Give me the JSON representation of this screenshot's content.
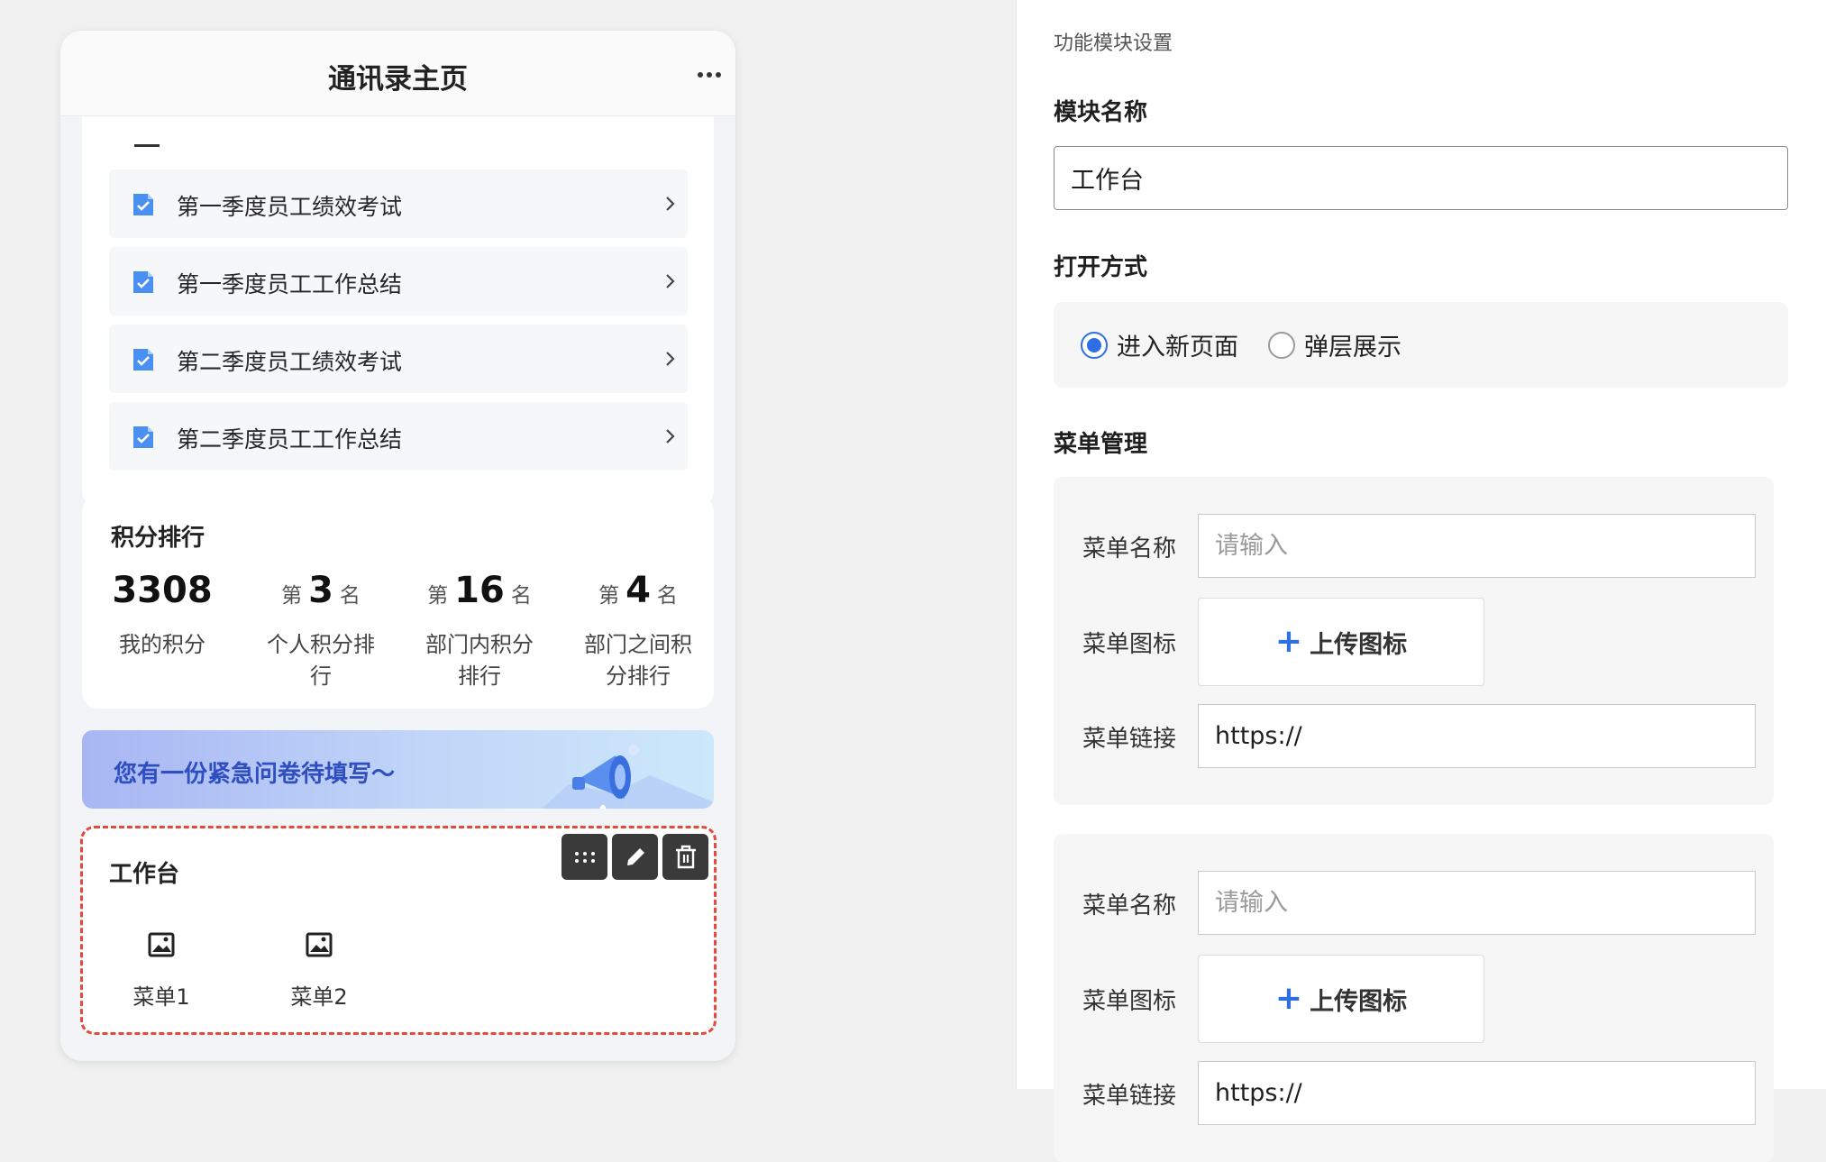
{
  "phone": {
    "title": "通讯录主页",
    "docs": [
      {
        "label": "第一季度员工绩效考试"
      },
      {
        "label": "第一季度员工工作总结"
      },
      {
        "label": "第二季度员工绩效考试"
      },
      {
        "label": "第二季度员工工作总结"
      }
    ],
    "score": {
      "title": "积分排行",
      "rank_prefix": "第",
      "rank_suffix": "名",
      "my_points": "3308",
      "my_points_label": "我的积分",
      "personal_rank": "3",
      "personal_rank_label": "个人积分排行",
      "dept_rank": "16",
      "dept_rank_label": "部门内积分排行",
      "inter_dept_rank": "4",
      "inter_dept_rank_label": "部门之间积分排行"
    },
    "banner": {
      "text": "您有一份紧急问卷待填写～"
    },
    "workbench": {
      "title": "工作台",
      "menus": [
        {
          "label": "菜单1"
        },
        {
          "label": "菜单2"
        }
      ]
    }
  },
  "panel": {
    "heading": "功能模块设置",
    "module_name_label": "模块名称",
    "module_name_value": "工作台",
    "open_mode_label": "打开方式",
    "open_mode_options": [
      {
        "label": "进入新页面",
        "selected": true
      },
      {
        "label": "弹层展示",
        "selected": false
      }
    ],
    "menu_manage_label": "菜单管理",
    "menu_groups": [
      {
        "name_label": "菜单名称",
        "name_placeholder": "请输入",
        "name_value": "",
        "icon_label": "菜单图标",
        "upload_text": "上传图标",
        "link_label": "菜单链接",
        "link_value": "https://"
      },
      {
        "name_label": "菜单名称",
        "name_placeholder": "请输入",
        "name_value": "",
        "icon_label": "菜单图标",
        "upload_text": "上传图标",
        "link_label": "菜单链接",
        "link_value": "https://"
      }
    ]
  },
  "colors": {
    "accent": "#2f6fe4",
    "selection_border": "#e24a3b",
    "banner_text": "#2f4fc0"
  },
  "icons": {
    "more": "more-horizontal-icon",
    "doc": "checked-document-icon",
    "chevron": "chevron-right-icon",
    "drag": "drag-handle-icon",
    "edit": "pencil-icon",
    "delete": "trash-icon",
    "menu_image": "image-icon",
    "megaphone": "megaphone-icon",
    "upload": "plus-icon"
  }
}
